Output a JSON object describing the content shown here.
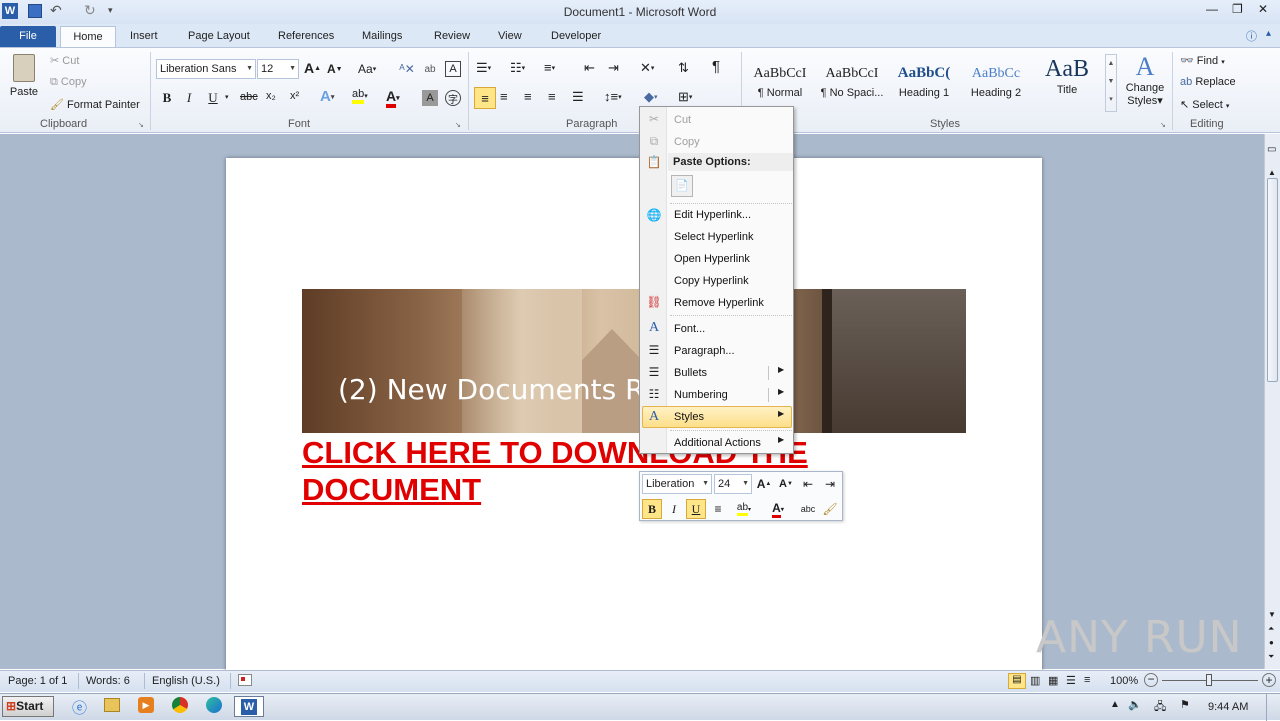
{
  "window": {
    "title": "Document1 - Microsoft Word",
    "minimize": "—",
    "restore": "❐",
    "close": "✕"
  },
  "tabs": [
    "File",
    "Home",
    "Insert",
    "Page Layout",
    "References",
    "Mailings",
    "Review",
    "View",
    "Developer"
  ],
  "clipboard": {
    "paste": "Paste",
    "cut": "Cut",
    "copy": "Copy",
    "format_painter": "Format Painter",
    "label": "Clipboard"
  },
  "font": {
    "name": "Liberation Sans",
    "size": "12",
    "label": "Font",
    "grow": "A",
    "shrink": "A",
    "change_case": "Aa",
    "bold": "B",
    "italic": "I",
    "underline": "U",
    "strike": "abc",
    "subscript": "x₂",
    "superscript": "x²"
  },
  "paragraph": {
    "label": "Paragraph",
    "pilcrow": "¶"
  },
  "styles": {
    "label": "Styles",
    "items": [
      {
        "preview": "AaBbCcI",
        "name": "¶ Normal"
      },
      {
        "preview": "AaBbCcI",
        "name": "¶ No Spaci..."
      },
      {
        "preview": "AaBbC(",
        "name": "Heading 1"
      },
      {
        "preview": "AaBbCc",
        "name": "Heading 2"
      },
      {
        "preview": "AaB",
        "name": "Title"
      }
    ],
    "change": "Change",
    "change2": "Styles"
  },
  "editing": {
    "label": "Editing",
    "find": "Find",
    "replace": "Replace",
    "select": "Select"
  },
  "document": {
    "image_caption": "(2) New Documents Re",
    "link_line1": "CLICK HERE TO DOWNLOAD THE",
    "link_line2": "DOCUMENT"
  },
  "context_menu": {
    "items": [
      {
        "label": "Cut",
        "disabled": true
      },
      {
        "label": "Copy",
        "disabled": true
      },
      {
        "label": "Paste Options:",
        "header": true
      },
      {
        "label": "Edit Hyperlink..."
      },
      {
        "label": "Select Hyperlink"
      },
      {
        "label": "Open Hyperlink"
      },
      {
        "label": "Copy Hyperlink"
      },
      {
        "label": "Remove Hyperlink"
      },
      {
        "label": "Font..."
      },
      {
        "label": "Paragraph..."
      },
      {
        "label": "Bullets"
      },
      {
        "label": "Numbering"
      },
      {
        "label": "Styles"
      },
      {
        "label": "Additional Actions"
      }
    ]
  },
  "mini_toolbar": {
    "font": "Liberation",
    "size": "24",
    "bold": "B",
    "italic": "I",
    "underline": "U"
  },
  "status": {
    "page": "Page: 1 of 1",
    "words": "Words: 6",
    "language": "English (U.S.)",
    "zoom": "100%"
  },
  "taskbar": {
    "start": "Start",
    "time": "9:44 AM"
  },
  "watermark": "ANY RUN",
  "colors": {
    "accent": "#2a5ea8",
    "link_red": "#e00000",
    "highlight": "#fde588"
  }
}
